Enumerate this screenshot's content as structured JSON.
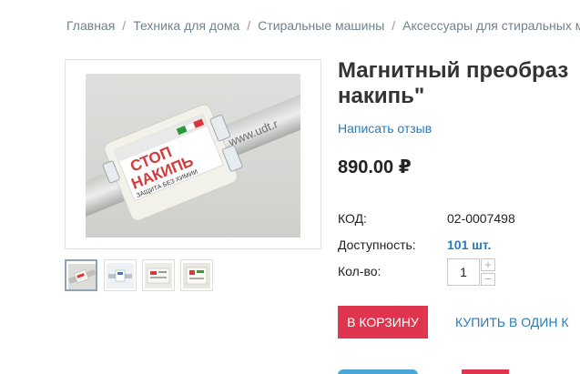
{
  "breadcrumb": {
    "items": [
      "Главная",
      "Техника для дома",
      "Стиральные машины",
      "Аксессуары для стиральных ма"
    ],
    "separator": "/"
  },
  "product": {
    "title_line1": "Магнитный преобраз",
    "title_line2": "накипь\"",
    "review_link": "Написать отзыв",
    "price": "890.00 ₽"
  },
  "specs": {
    "code_label": "КОД:",
    "code_value": "02-0007498",
    "availability_label": "Доступность:",
    "availability_value": "101 шт.",
    "qty_label": "Кол-во:"
  },
  "quantity": {
    "value": "1",
    "plus": "+",
    "minus": "−"
  },
  "actions": {
    "add_to_cart": "В КОРЗИНУ",
    "buy_one_click": "КУПИТЬ В ОДИН К"
  },
  "image": {
    "label_line1": "СТОП",
    "label_line2": "НАКИПЬ",
    "label_line3": "ЗАЩИТА БЕЗ ХИМИИ",
    "pipe_text": "www.udt.r"
  },
  "colors": {
    "accent_red": "#e0354f",
    "link_blue": "#2a7ab8"
  }
}
